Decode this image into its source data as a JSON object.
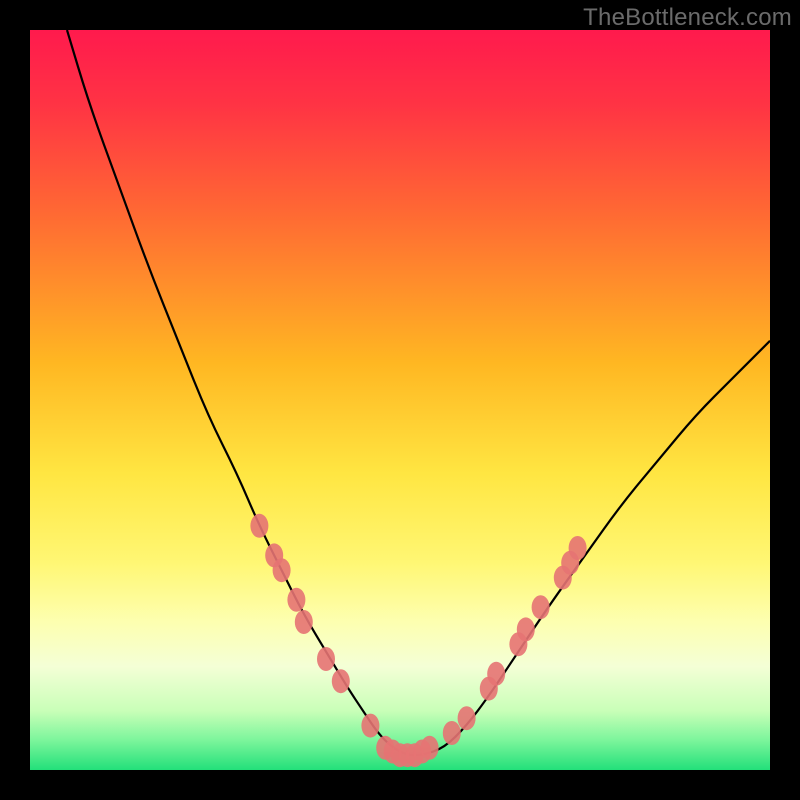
{
  "watermark": "TheBottleneck.com",
  "chart_data": {
    "type": "line",
    "title": "",
    "xlabel": "",
    "ylabel": "",
    "xlim": [
      0,
      100
    ],
    "ylim": [
      0,
      100
    ],
    "grid": false,
    "legend": false,
    "gradient_stops": [
      {
        "pct": 0,
        "color": "#ff1a4d"
      },
      {
        "pct": 10,
        "color": "#ff3344"
      },
      {
        "pct": 25,
        "color": "#ff6a33"
      },
      {
        "pct": 45,
        "color": "#ffb722"
      },
      {
        "pct": 60,
        "color": "#ffe642"
      },
      {
        "pct": 72,
        "color": "#fff774"
      },
      {
        "pct": 80,
        "color": "#fdffb0"
      },
      {
        "pct": 86,
        "color": "#f4ffd6"
      },
      {
        "pct": 92,
        "color": "#c9ffb8"
      },
      {
        "pct": 96,
        "color": "#7bf59b"
      },
      {
        "pct": 100,
        "color": "#22e07a"
      }
    ],
    "series": [
      {
        "name": "bottleneck-curve",
        "x": [
          5,
          8,
          12,
          16,
          20,
          24,
          28,
          31,
          34,
          37,
          40,
          43,
          45,
          47,
          49,
          51,
          53,
          56,
          59,
          62,
          66,
          70,
          75,
          80,
          85,
          90,
          95,
          100
        ],
        "y": [
          100,
          90,
          79,
          68,
          58,
          48,
          40,
          33,
          27,
          21,
          16,
          11,
          8,
          5,
          3,
          2,
          2,
          3,
          6,
          10,
          16,
          22,
          29,
          36,
          42,
          48,
          53,
          58
        ]
      }
    ],
    "markers": {
      "name": "highlight-points",
      "color": "#e57373",
      "points": [
        {
          "x": 31,
          "y": 33
        },
        {
          "x": 33,
          "y": 29
        },
        {
          "x": 34,
          "y": 27
        },
        {
          "x": 36,
          "y": 23
        },
        {
          "x": 37,
          "y": 20
        },
        {
          "x": 40,
          "y": 15
        },
        {
          "x": 42,
          "y": 12
        },
        {
          "x": 46,
          "y": 6
        },
        {
          "x": 48,
          "y": 3
        },
        {
          "x": 49,
          "y": 2.5
        },
        {
          "x": 50,
          "y": 2
        },
        {
          "x": 51,
          "y": 2
        },
        {
          "x": 52,
          "y": 2
        },
        {
          "x": 53,
          "y": 2.5
        },
        {
          "x": 54,
          "y": 3
        },
        {
          "x": 57,
          "y": 5
        },
        {
          "x": 59,
          "y": 7
        },
        {
          "x": 62,
          "y": 11
        },
        {
          "x": 63,
          "y": 13
        },
        {
          "x": 66,
          "y": 17
        },
        {
          "x": 67,
          "y": 19
        },
        {
          "x": 69,
          "y": 22
        },
        {
          "x": 72,
          "y": 26
        },
        {
          "x": 73,
          "y": 28
        },
        {
          "x": 74,
          "y": 30
        }
      ]
    }
  }
}
